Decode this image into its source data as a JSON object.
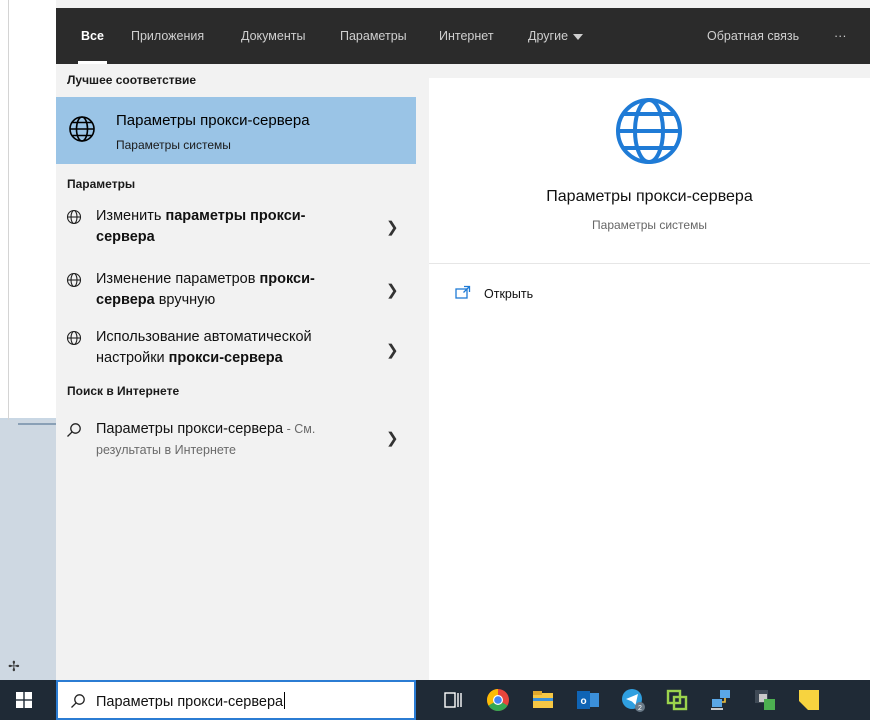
{
  "tabs": [
    {
      "label": "Все",
      "active": true
    },
    {
      "label": "Приложения"
    },
    {
      "label": "Документы"
    },
    {
      "label": "Параметры"
    },
    {
      "label": "Интернет"
    },
    {
      "label": "Другие"
    }
  ],
  "feedback": "Обратная связь",
  "more": "···",
  "best_match": {
    "heading": "Лучшее соответствие",
    "title": "Параметры прокси-сервера",
    "subtitle": "Параметры системы"
  },
  "settings": {
    "heading": "Параметры",
    "items": [
      {
        "l1a": "Изменить ",
        "l1b": "параметры прокси-",
        "l2a": "сервера",
        "l2b": ""
      },
      {
        "l1a": "Изменение параметров ",
        "l1b": "прокси-",
        "l2a": "сервера",
        "l2b": " вручную"
      },
      {
        "l1a": "Использование автоматической",
        "l1b": "",
        "l2a": "настройки ",
        "l2b": "прокси-сервера"
      }
    ]
  },
  "web": {
    "heading": "Поиск в Интернете",
    "query": "Параметры прокси-сервера",
    "suffix": " - См.",
    "line2": "результаты в Интернете"
  },
  "detail": {
    "title": "Параметры прокси-сервера",
    "subtitle": "Параметры системы",
    "action": "Открыть"
  },
  "search": {
    "value": "Параметры прокси-сервера"
  },
  "taskbar_icons": [
    "task-view-icon",
    "chrome-icon",
    "file-explorer-icon",
    "outlook-icon",
    "telegram-icon",
    "vmware-icon",
    "network-icon",
    "citrix-icon",
    "sticky-notes-icon"
  ],
  "colors": {
    "accent": "#2b7cd3",
    "selection": "#9ac4e6",
    "topbar": "#2b2b2b",
    "taskbar": "#1f2a36"
  }
}
